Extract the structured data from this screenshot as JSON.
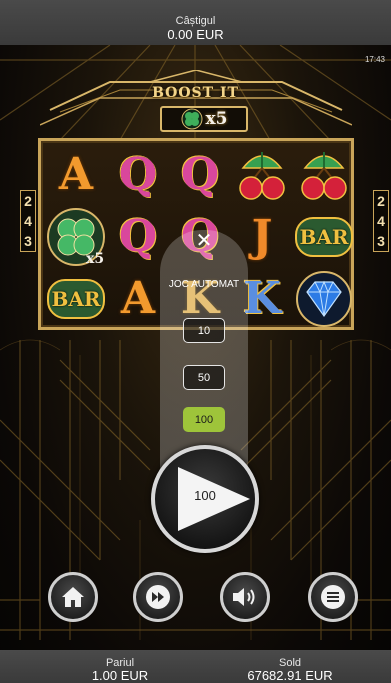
{
  "header": {
    "win_label": "Câștigul",
    "win_value": "0.00 EUR",
    "clock": "17:43"
  },
  "game": {
    "title": "BOOST IT",
    "multiplier": "x5"
  },
  "reels": {
    "side_left": [
      "2",
      "4",
      "3"
    ],
    "side_right": [
      "2",
      "4",
      "3"
    ],
    "grid": [
      [
        "A",
        "Q",
        "Q",
        "cherries",
        "cherries"
      ],
      [
        "clover",
        "Q",
        "Q",
        "J",
        "BAR"
      ],
      [
        "BAR",
        "A",
        "K",
        "K",
        "diamond"
      ]
    ]
  },
  "autoplay": {
    "title": "JOC AUTOMAT",
    "options": [
      "10",
      "50",
      "100"
    ],
    "selected": "100",
    "close_icon": "close-icon"
  },
  "spin": {
    "count": "100",
    "icon": "play-icon"
  },
  "controls": {
    "home_icon": "home-icon",
    "turbo_icon": "fast-forward-icon",
    "sound_icon": "speaker-icon",
    "menu_icon": "hamburger-menu-icon"
  },
  "footer": {
    "bet_label": "Pariul",
    "bet_value": "1.00 EUR",
    "balance_label": "Sold",
    "balance_value": "67682.91 EUR"
  },
  "colors": {
    "gold": "#c9a55a",
    "selected_option": "#9ec43a",
    "bar_bg": "#3f3f3f"
  }
}
